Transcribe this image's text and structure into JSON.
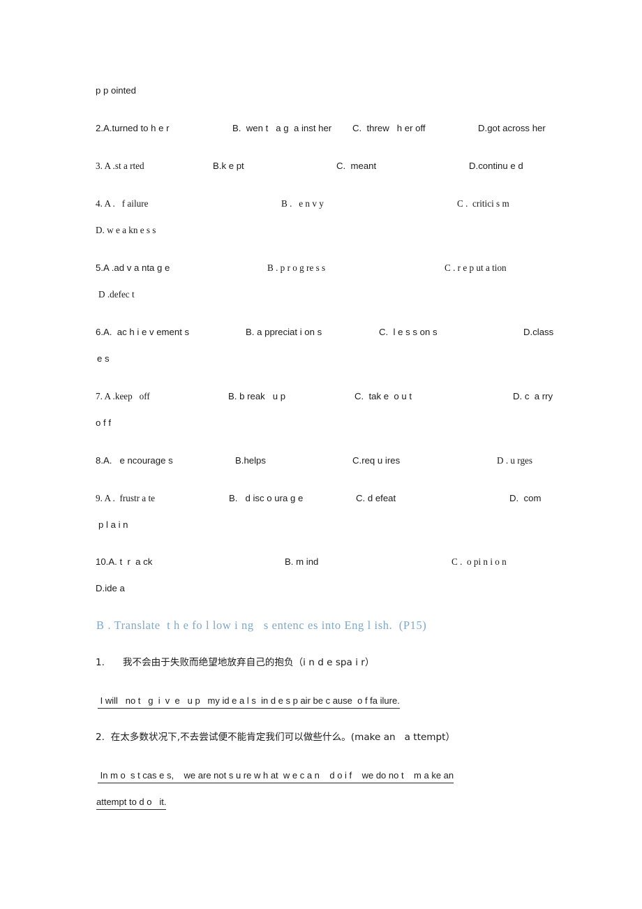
{
  "document": {
    "page_background": "#ffffff",
    "body_text_color": "#1b1b1b",
    "heading_color": "#7fa8c8"
  },
  "continuation_line": {
    "text": "p p ointed"
  },
  "multiple_choice": {
    "questions": [
      {
        "number": "2.",
        "options": [
          {
            "letter": "A",
            "text": "2.A.turned to h e r"
          },
          {
            "letter": "B",
            "text": "B.  wen t   a g  a inst her"
          },
          {
            "letter": "C",
            "text": "C.  threw   h er off"
          },
          {
            "letter": "D",
            "text": "D.got across her"
          }
        ],
        "wrap": null
      },
      {
        "number": "3.",
        "options": [
          {
            "letter": "A",
            "text": "3. A .st a rted"
          },
          {
            "letter": "B",
            "text": "B.k e pt"
          },
          {
            "letter": "C",
            "text": "C.  meant"
          },
          {
            "letter": "D",
            "text": "D.continu e d"
          }
        ],
        "wrap": null
      },
      {
        "number": "4.",
        "options": [
          {
            "letter": "A",
            "text": "4. A .   f ailure"
          },
          {
            "letter": "B",
            "text": "B .   e n v y"
          },
          {
            "letter": "C",
            "text": "C .  critici s m"
          }
        ],
        "wrap": "D. w e a kn e s s"
      },
      {
        "number": "5.",
        "options": [
          {
            "letter": "A",
            "text": "5.A .ad v a nta g e"
          },
          {
            "letter": "B",
            "text": "B . p r o g re s s"
          },
          {
            "letter": "C",
            "text": "C . r e p ut a tion"
          }
        ],
        "wrap": "D .defec t"
      },
      {
        "number": "6.",
        "options": [
          {
            "letter": "A",
            "text": "6.A.  ac h i e v ement s"
          },
          {
            "letter": "B",
            "text": "B. a ppreciat i on s"
          },
          {
            "letter": "C",
            "text": "C.  l e s s on s"
          },
          {
            "letter": "D",
            "text": "D.class"
          }
        ],
        "wrap": "e s"
      },
      {
        "number": "7.",
        "options": [
          {
            "letter": "A",
            "text": "7. A .keep   off"
          },
          {
            "letter": "B",
            "text": "B. b reak   u p"
          },
          {
            "letter": "C",
            "text": "C.  tak e  o u t"
          },
          {
            "letter": "D",
            "text": "D. c  a rry"
          }
        ],
        "wrap": "o f f"
      },
      {
        "number": "8.",
        "options": [
          {
            "letter": "A",
            "text": "8.A.   e ncourage s"
          },
          {
            "letter": "B",
            "text": "B.helps"
          },
          {
            "letter": "C",
            "text": "C.req u ires"
          },
          {
            "letter": "D",
            "text": "D . u rges"
          }
        ],
        "wrap": null
      },
      {
        "number": "9.",
        "options": [
          {
            "letter": "A",
            "text": "9. A .  frustr a te"
          },
          {
            "letter": "B",
            "text": "B.   d isc o ura g e"
          },
          {
            "letter": "C",
            "text": "C. d efeat"
          },
          {
            "letter": "D",
            "text": "D.  com"
          }
        ],
        "wrap": "p l a i n"
      },
      {
        "number": "10.",
        "options": [
          {
            "letter": "A",
            "text": "10.A. t  r  a ck"
          },
          {
            "letter": "B",
            "text": "B. m ind"
          },
          {
            "letter": "C",
            "text": "C .  o pi n i o n"
          }
        ],
        "wrap": "D.ide a"
      }
    ]
  },
  "translate_section": {
    "heading": "B . Translate  t h e fo l low i ng   s entenc es into Eng l ish.  (P15)",
    "items": [
      {
        "number": "1.",
        "prompt": "1.      我不会由于失败而绝望地放弃自己的抱负（i n d e spa i r）",
        "answer_lines": [
          " I will   no t   g  i  v  e   u p   my id e a l s  in d e s p air be c ause  o f fa ilure."
        ]
      },
      {
        "number": "2.",
        "prompt": "2.  在太多数状况下,不去尝试便不能肯定我们可以做些什么。(make an   a ttempt）",
        "answer_lines": [
          " In m o  s t cas e s,    we are not s u re w h at  w e c a n    d o i f    we do no t    m a ke an",
          "attempt to d o   it."
        ]
      }
    ]
  }
}
